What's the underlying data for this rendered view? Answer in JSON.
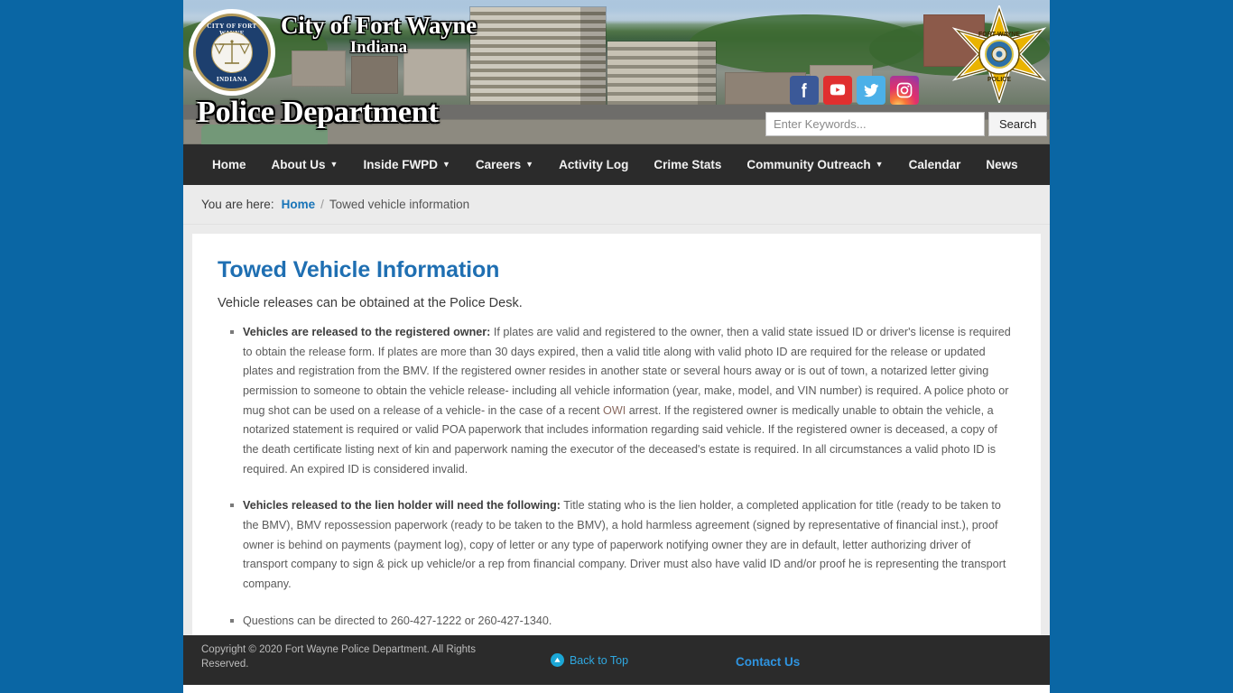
{
  "site": {
    "city_name": "City of Fort Wayne",
    "state_name": "Indiana",
    "department": "Police Department",
    "seal_top_text": "CITY OF FORT WAYNE",
    "seal_bottom_text": "INDIANA",
    "badge_top_text": "FORT WAYNE",
    "badge_bottom_text": "POLICE"
  },
  "social": [
    {
      "name": "facebook",
      "label": "Facebook"
    },
    {
      "name": "youtube",
      "label": "YouTube"
    },
    {
      "name": "twitter",
      "label": "Twitter"
    },
    {
      "name": "instagram",
      "label": "Instagram"
    }
  ],
  "search": {
    "placeholder": "Enter Keywords...",
    "value": "",
    "button_label": "Search"
  },
  "nav": {
    "items": [
      {
        "label": "Home",
        "has_dropdown": false
      },
      {
        "label": "About Us",
        "has_dropdown": true
      },
      {
        "label": "Inside FWPD",
        "has_dropdown": true
      },
      {
        "label": "Careers",
        "has_dropdown": true
      },
      {
        "label": "Activity Log",
        "has_dropdown": false
      },
      {
        "label": "Crime Stats",
        "has_dropdown": false
      },
      {
        "label": "Community Outreach",
        "has_dropdown": true
      },
      {
        "label": "Calendar",
        "has_dropdown": false
      },
      {
        "label": "News",
        "has_dropdown": false
      }
    ]
  },
  "breadcrumb": {
    "prefix": "You are here:",
    "home": "Home",
    "separator": "/",
    "current": "Towed vehicle information"
  },
  "main": {
    "title": "Towed Vehicle Information",
    "intro": "Vehicle releases can be obtained at the Police Desk.",
    "bullets": [
      {
        "lead": "Vehicles are released to the registered owner:",
        "body_before_owi": " If plates are valid and registered to the owner, then a valid state issued ID or driver's license is required to obtain the release form.  If plates are more than 30 days expired, then a valid title along with valid photo ID are required for the release or updated plates and registration from the BMV.  If the registered owner resides in another state or several hours away or is out of town, a notarized letter giving permission to someone to obtain the vehicle release- including all vehicle information (year, make, model, and VIN number) is required.  A police photo or mug shot can be used on a release of a vehicle- in the case of a recent ",
        "highlight": "OWI",
        "body_after_owi": " arrest.  If the registered owner is medically unable to obtain the vehicle, a notarized statement is required or valid POA paperwork that includes information regarding said vehicle.  If the registered owner is deceased, a copy of the death certificate listing next of kin and paperwork naming the executor of the deceased's estate is required.  In all circumstances a valid photo ID is required.   An expired ID is considered invalid."
      },
      {
        "lead": "Vehicles released to the lien holder will need the following:",
        "body_before_owi": " Title stating who is the lien holder, a completed application for title (ready to be taken to the BMV), BMV repossession paperwork   (ready to be taken to the BMV), a hold harmless agreement (signed by representative of financial inst.), proof owner is behind on payments (payment log), copy of letter or any type of paperwork notifying owner they are in default, letter authorizing driver of transport company to sign & pick up vehicle/or a rep from financial company. Driver must also have valid ID and/or proof he is representing the transport company.",
        "highlight": "",
        "body_after_owi": ""
      },
      {
        "lead": "",
        "body_before_owi": "Questions can be directed to 260-427-1222 or 260-427-1340.",
        "highlight": "",
        "body_after_owi": ""
      }
    ]
  },
  "footer": {
    "copyright": "Copyright © 2020 Fort Wayne Police Department. All Rights Reserved.",
    "back_to_top": "Back to Top",
    "contact_us": "Contact Us"
  },
  "colors": {
    "page_background": "#0a66a4",
    "nav_background": "#2b2b2b",
    "title_blue": "#1f6fb2",
    "link_blue": "#1874b8",
    "footer_link_blue": "#2f94e0",
    "back_to_top_blue": "#2fa8e0"
  }
}
